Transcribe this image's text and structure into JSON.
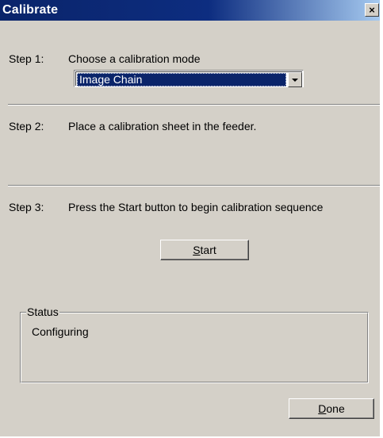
{
  "window": {
    "title": "Calibrate",
    "close_glyph": "×"
  },
  "step1": {
    "number": "Step 1:",
    "text": "Choose a calibration mode",
    "combo_value": "Image Chain"
  },
  "step2": {
    "number": "Step 2:",
    "text": "Place a calibration sheet in the feeder."
  },
  "step3": {
    "number": "Step 3:",
    "text": "Press the Start button to begin calibration sequence"
  },
  "start_button": {
    "mnemonic": "S",
    "rest": "tart"
  },
  "status": {
    "legend": "Status",
    "text": "Configuring"
  },
  "done_button": {
    "mnemonic": "D",
    "rest": "one"
  },
  "colors": {
    "title_bar": "#0a246a",
    "dialog_face": "#d4d0c8",
    "selection": "#0a246a"
  },
  "icons": {
    "close": "close-icon",
    "dropdown": "chevron-down-icon"
  }
}
